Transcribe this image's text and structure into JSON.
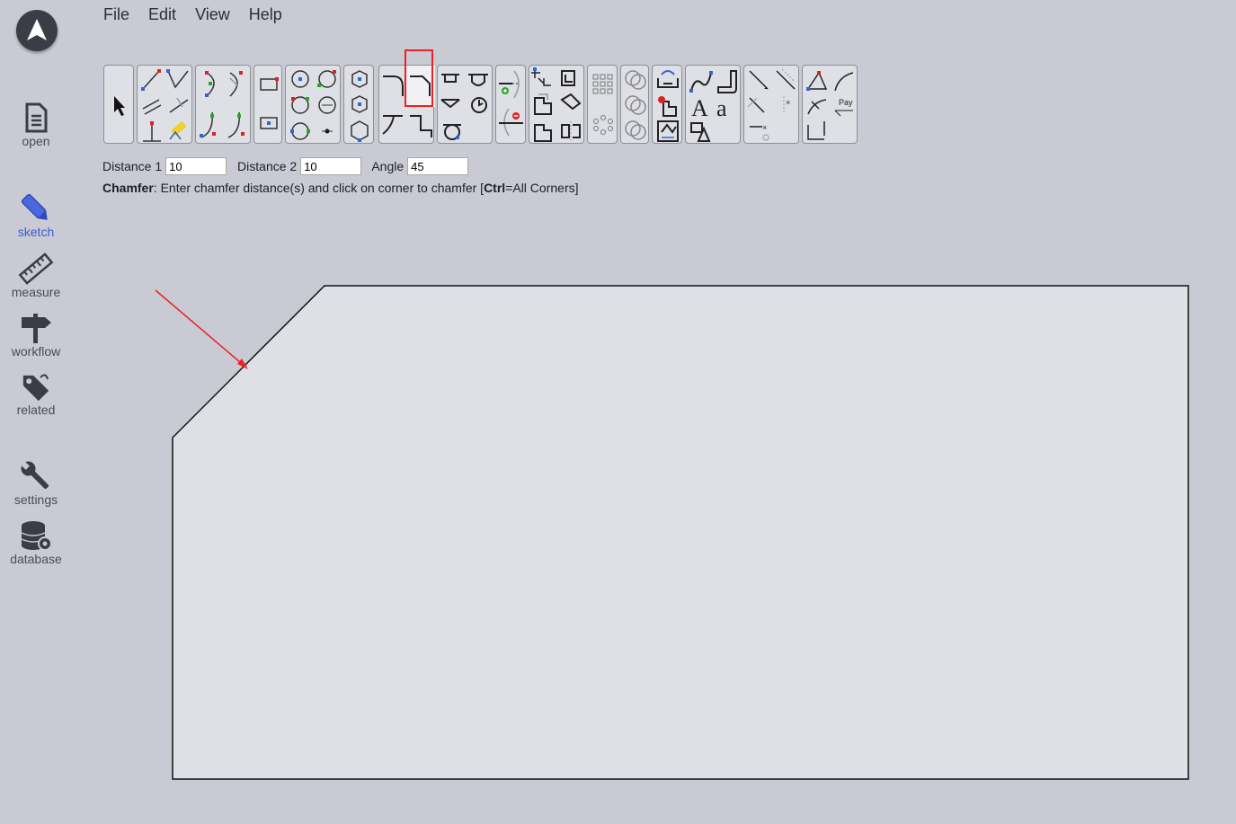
{
  "menu": {
    "file": "File",
    "edit": "Edit",
    "view": "View",
    "help": "Help"
  },
  "sidebar": {
    "open": "open",
    "sketch": "sketch",
    "measure": "measure",
    "workflow": "workflow",
    "related": "related",
    "settings": "settings",
    "database": "database"
  },
  "params": {
    "distance1_label": "Distance 1",
    "distance1_value": "10",
    "distance2_label": "Distance 2",
    "distance2_value": "10",
    "angle_label": "Angle",
    "angle_value": "45"
  },
  "hint": {
    "tool": "Chamfer",
    "text_before": ": Enter chamfer distance(s) and click on corner to chamfer [",
    "key": "Ctrl",
    "text_after": "=All Corners]"
  },
  "toolbar_sample_text": {
    "font_a": "A",
    "font_a2": "a",
    "pay": "Pay"
  },
  "colors": {
    "accent_red": "#e22222",
    "sketch_active": "#3b5bd6",
    "background": "#c9cad3",
    "canvas_fill": "#dfe0e6"
  }
}
